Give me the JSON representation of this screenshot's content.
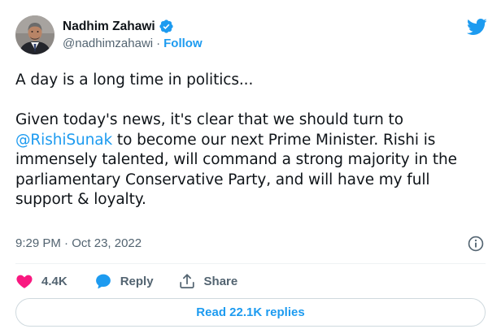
{
  "author": {
    "name": "Nadhim Zahawi",
    "handle": "@nadhimzahawi",
    "separator": "·",
    "follow_label": "Follow",
    "verified": true
  },
  "tweet": {
    "line1": "A day is a long time in politics...",
    "para2_start": "Given today's news, it's clear that we should turn to",
    "mention": "@RishiSunak",
    "para2_rest": " to become our next Prime Minister. Rishi is immensely talented, will command a strong majority in the parliamentary Conservative Party, and will have my full support & loyalty.",
    "time": "9:29 PM",
    "separator": " · ",
    "date": "Oct 23, 2022"
  },
  "actions": {
    "like_count": "4.4K",
    "reply_label": "Reply",
    "share_label": "Share"
  },
  "read_replies_label": "Read 22.1K replies",
  "colors": {
    "accent": "#1d9bf0",
    "like": "#f91880",
    "text": "#0f1419",
    "secondary": "#536471",
    "border": "#cfd9de"
  },
  "icons": {
    "brand": "twitter-bird-icon",
    "verified": "verified-badge-icon",
    "info": "info-icon",
    "like": "heart-icon",
    "reply": "speech-bubble-icon",
    "share": "share-upload-icon"
  }
}
